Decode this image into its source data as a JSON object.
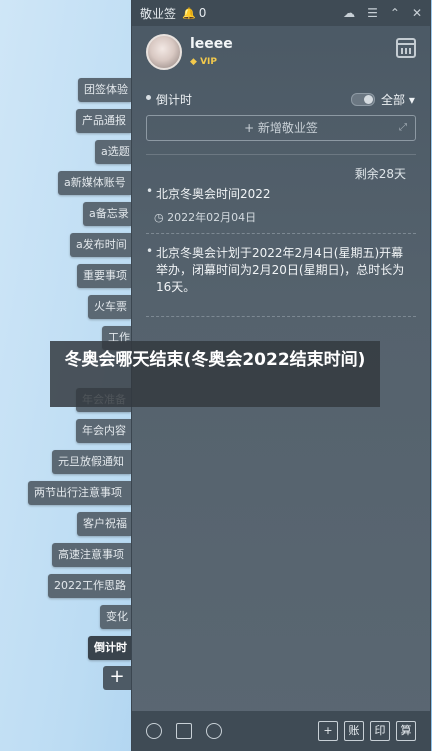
{
  "left_tabs": [
    {
      "label": "团签体验",
      "active": false
    },
    {
      "label": "产品通报",
      "active": false
    },
    {
      "label": "a选题",
      "active": false
    },
    {
      "label": "a新媒体账号",
      "active": false
    },
    {
      "label": "a备忘录",
      "active": false
    },
    {
      "label": "a发布时间",
      "active": false
    },
    {
      "label": "重要事项",
      "active": false
    },
    {
      "label": "火车票",
      "active": false
    },
    {
      "label": "工作",
      "active": false
    },
    {
      "label": "年会准备",
      "active": false
    },
    {
      "label": "年会内容",
      "active": false
    },
    {
      "label": "元旦放假通知",
      "active": false
    },
    {
      "label": "两节出行注意事项",
      "active": false
    },
    {
      "label": "客户祝福",
      "active": false
    },
    {
      "label": "高速注意事项",
      "active": false
    },
    {
      "label": "2022工作思路",
      "active": false
    },
    {
      "label": "变化",
      "active": false
    },
    {
      "label": "倒计时",
      "active": true
    }
  ],
  "add_tab_label": "+",
  "titlebar": {
    "app_name": "敬业签",
    "notification_count": "0"
  },
  "profile": {
    "username": "leeee",
    "vip_label": "VIP"
  },
  "section": {
    "title": "倒计时",
    "filter_label": "全部"
  },
  "add_note_label": "+ 新增敬业签",
  "remaining_label": "剩余28天",
  "items": [
    {
      "title": "北京冬奥会时间2022",
      "date": "2022年02月04日"
    },
    {
      "body": "北京冬奥会计划于2022年2月4日(星期五)开幕举办，闭幕时间为2月20日(星期日)，总时长为16天。"
    }
  ],
  "bottom_buttons": [
    "+",
    "账",
    "印",
    "算"
  ],
  "overlay_title": "冬奥会哪天结束(冬奥会2022结束时间)",
  "icons": {
    "bell": "bell-icon",
    "cloud": "cloud-icon",
    "menu": "menu-icon",
    "collapse": "chevron-up-icon",
    "close": "close-icon",
    "calendar": "calendar-icon",
    "clock": "clock-icon",
    "check": "checkbox-icon",
    "search": "search-icon"
  }
}
